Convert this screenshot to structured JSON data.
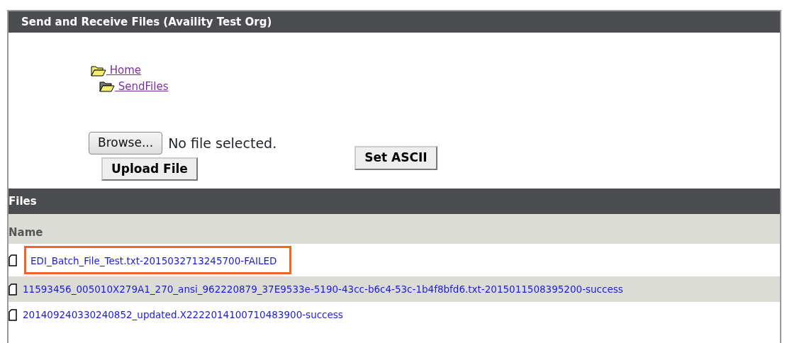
{
  "panel": {
    "title": "Send and Receive Files (Availity Test Org)"
  },
  "folders": [
    {
      "label": "Home",
      "children": [
        {
          "label": "SendFiles"
        }
      ]
    }
  ],
  "upload": {
    "browse_button": "Browse...",
    "file_status": "No file selected.",
    "upload_button": "Upload File",
    "ascii_button": "Set ASCII"
  },
  "files": {
    "title": "Files",
    "column": "Name",
    "rows": [
      {
        "name": "EDI_Batch_File_Test.txt-2015032713245700-FAILED",
        "highlighted": true
      },
      {
        "name": "11593456_005010X279A1_270_ansi_962220879_37E9533e-5190-43cc-b6c4-53c-1b4f8bfd6.txt-2015011508395200-success",
        "highlighted": false
      },
      {
        "name": "201409240330240852_updated.X2222014100710483900-success",
        "highlighted": false
      }
    ]
  }
}
